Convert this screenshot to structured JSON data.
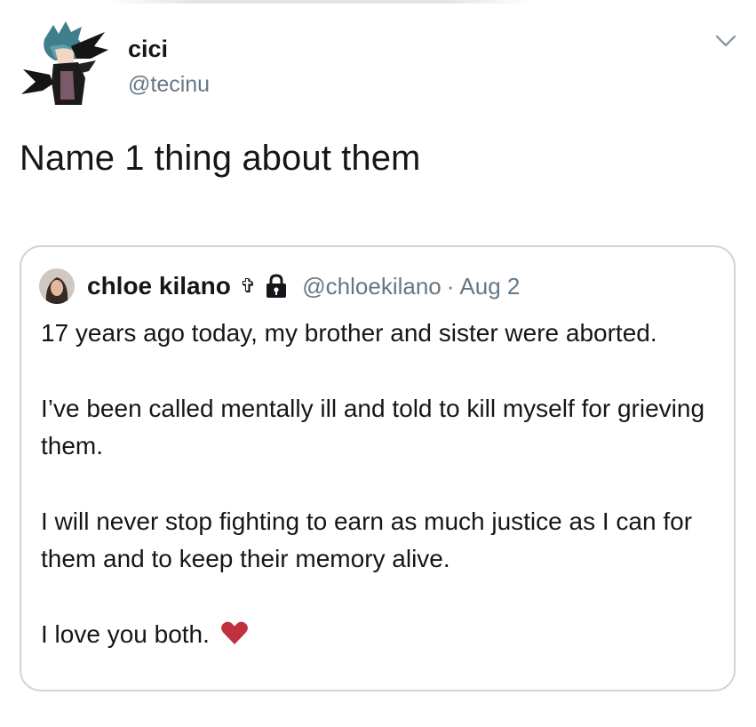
{
  "tweet": {
    "author": {
      "display_name": "cici",
      "handle": "@tecinu",
      "avatar_icon": "anime-character-avatar"
    },
    "menu_icon": "chevron-down-icon",
    "text": "Name 1 thing about them"
  },
  "quoted_tweet": {
    "author": {
      "display_name": "chloe kilano",
      "name_emoji": "✞",
      "lock_icon": "lock-icon",
      "handle": "@chloekilano",
      "separator": "·",
      "date": "Aug 2",
      "avatar_icon": "profile-photo-avatar"
    },
    "paragraphs": [
      "17 years ago today, my brother and sister were aborted.",
      "I’ve been called mentally ill and told to kill myself for grieving them.",
      "I will never stop fighting to earn as much justice as I can for them and to keep their memory alive.",
      "I love you both."
    ],
    "end_emoji": "heart-icon"
  },
  "colors": {
    "text_primary": "#14171a",
    "text_secondary": "#657786",
    "card_border": "#ccd6dd",
    "heart": "#c0303f"
  }
}
